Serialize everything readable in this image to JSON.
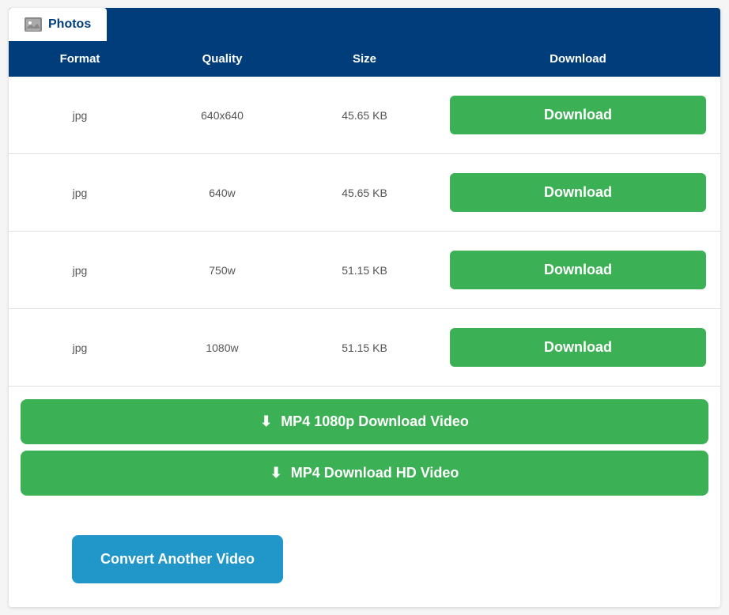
{
  "tab": {
    "icon": "📷",
    "label": "Photos"
  },
  "table": {
    "headers": [
      "Format",
      "Quality",
      "Size",
      "Download"
    ],
    "rows": [
      {
        "format": "jpg",
        "quality": "640x640",
        "size": "45.65 KB",
        "download": "Download"
      },
      {
        "format": "jpg",
        "quality": "640w",
        "size": "45.65 KB",
        "download": "Download"
      },
      {
        "format": "jpg",
        "quality": "750w",
        "size": "51.15 KB",
        "download": "Download"
      },
      {
        "format": "jpg",
        "quality": "1080w",
        "size": "51.15 KB",
        "download": "Download"
      }
    ]
  },
  "action_buttons": [
    {
      "label": "MP4 1080p Download Video"
    },
    {
      "label": "MP4 Download HD Video"
    }
  ],
  "convert_button": {
    "label": "Convert Another Video"
  },
  "colors": {
    "header_bg": "#003d7a",
    "green": "#3cb054",
    "blue": "#2196c9"
  }
}
